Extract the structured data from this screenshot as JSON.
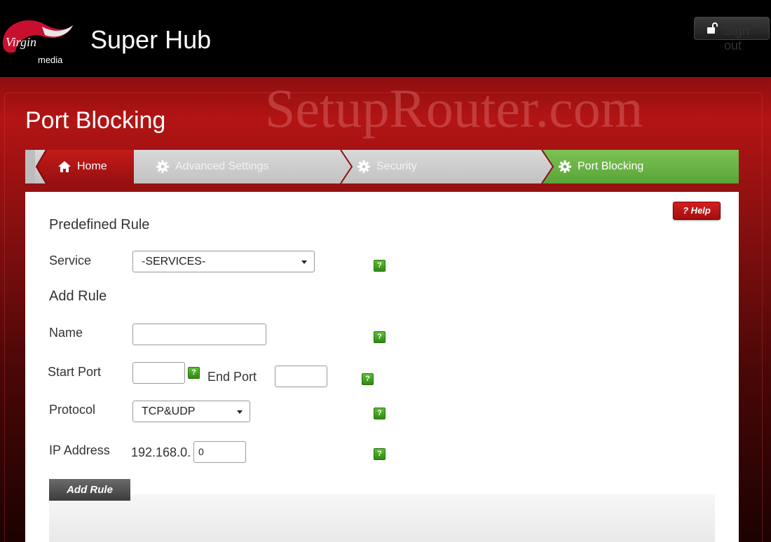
{
  "header": {
    "brand": "Virgin media",
    "title": "Super Hub",
    "sign_out_label": "Sign out"
  },
  "watermark": "SetupRouter.com",
  "page": {
    "title": "Port Blocking"
  },
  "breadcrumb": [
    {
      "label": "Home",
      "icon": "home-icon"
    },
    {
      "label": "Advanced Settings",
      "icon": "gear-icon"
    },
    {
      "label": "Security",
      "icon": "gear-icon"
    },
    {
      "label": "Port Blocking",
      "icon": "gear-icon"
    }
  ],
  "help_label": "? Help",
  "predefined": {
    "title": "Predefined Rule",
    "service_label": "Service",
    "service_value": "-SERVICES-"
  },
  "add_rule": {
    "title": "Add Rule",
    "name_label": "Name",
    "name_value": "",
    "start_port_label": "Start Port",
    "start_port_value": "",
    "end_port_label": "End Port",
    "end_port_value": "",
    "protocol_label": "Protocol",
    "protocol_value": "TCP&UDP",
    "ip_label": "IP Address",
    "ip_prefix": "192.168.0.",
    "ip_value": "0",
    "button_label": "Add Rule"
  },
  "colors": {
    "brand_red": "#b31414",
    "breadcrumb_active": "#6bb34a",
    "help_icon": "#3f9f1e"
  }
}
